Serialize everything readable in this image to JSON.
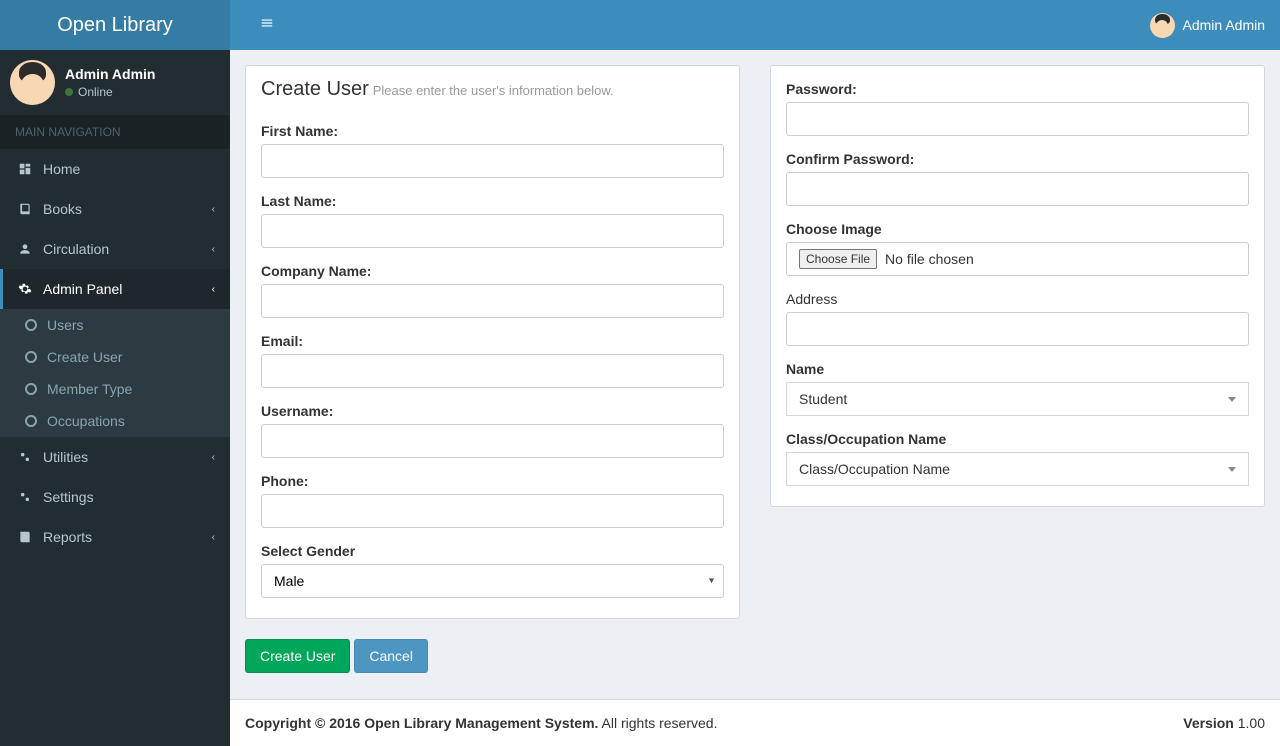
{
  "app": {
    "name": "Open Library"
  },
  "header": {
    "user_name": "Admin Admin"
  },
  "sidebar": {
    "user_name": "Admin Admin",
    "status": "Online",
    "nav_header": "MAIN NAVIGATION",
    "items": [
      {
        "label": "Home",
        "icon": "dashboard",
        "expandable": false
      },
      {
        "label": "Books",
        "icon": "book",
        "expandable": true
      },
      {
        "label": "Circulation",
        "icon": "user",
        "expandable": true
      },
      {
        "label": "Admin Panel",
        "icon": "gear",
        "expandable": true,
        "active": true,
        "children": [
          {
            "label": "Users"
          },
          {
            "label": "Create User"
          },
          {
            "label": "Member Type"
          },
          {
            "label": "Occupations"
          }
        ]
      },
      {
        "label": "Utilities",
        "icon": "gears",
        "expandable": true
      },
      {
        "label": "Settings",
        "icon": "gears",
        "expandable": false
      },
      {
        "label": "Reports",
        "icon": "book",
        "expandable": true
      }
    ]
  },
  "form": {
    "title": "Create User",
    "subtitle": "Please enter the user's information below.",
    "left": {
      "first_name_label": "First Name:",
      "last_name_label": "Last Name:",
      "company_label": "Company Name:",
      "email_label": "Email:",
      "username_label": "Username:",
      "phone_label": "Phone:",
      "gender_label": "Select Gender",
      "gender_value": "Male"
    },
    "right": {
      "password_label": "Password:",
      "confirm_label": "Confirm Password:",
      "image_label": "Choose Image",
      "file_button": "Choose File",
      "file_text": "No file chosen",
      "address_label": "Address",
      "name_label": "Name",
      "name_value": "Student",
      "class_label": "Class/Occupation Name",
      "class_value": "Class/Occupation Name"
    },
    "submit": "Create User",
    "cancel": "Cancel"
  },
  "footer": {
    "copyright_bold": "Copyright © 2016 Open Library Management System.",
    "copyright_rest": " All rights reserved.",
    "version_label": "Version",
    "version": " 1.00"
  }
}
